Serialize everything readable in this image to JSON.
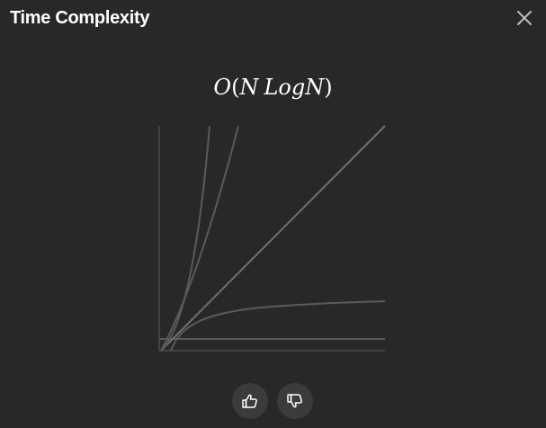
{
  "dialog": {
    "title": "Time Complexity"
  },
  "formula": {
    "notation": "O",
    "open_paren": "(",
    "term1": "N",
    "term2": "LogN",
    "close_paren": ")"
  },
  "icons": {
    "close": "close-icon",
    "thumbs_up": "thumbs-up-icon",
    "thumbs_down": "thumbs-down-icon"
  },
  "colors": {
    "background": "#282828",
    "text": "#ffffff",
    "axis": "#4a4a4a",
    "curve_default": "#5a5a5a",
    "curve_highlight": "#707070",
    "button_bg": "#3b3b3b"
  }
}
